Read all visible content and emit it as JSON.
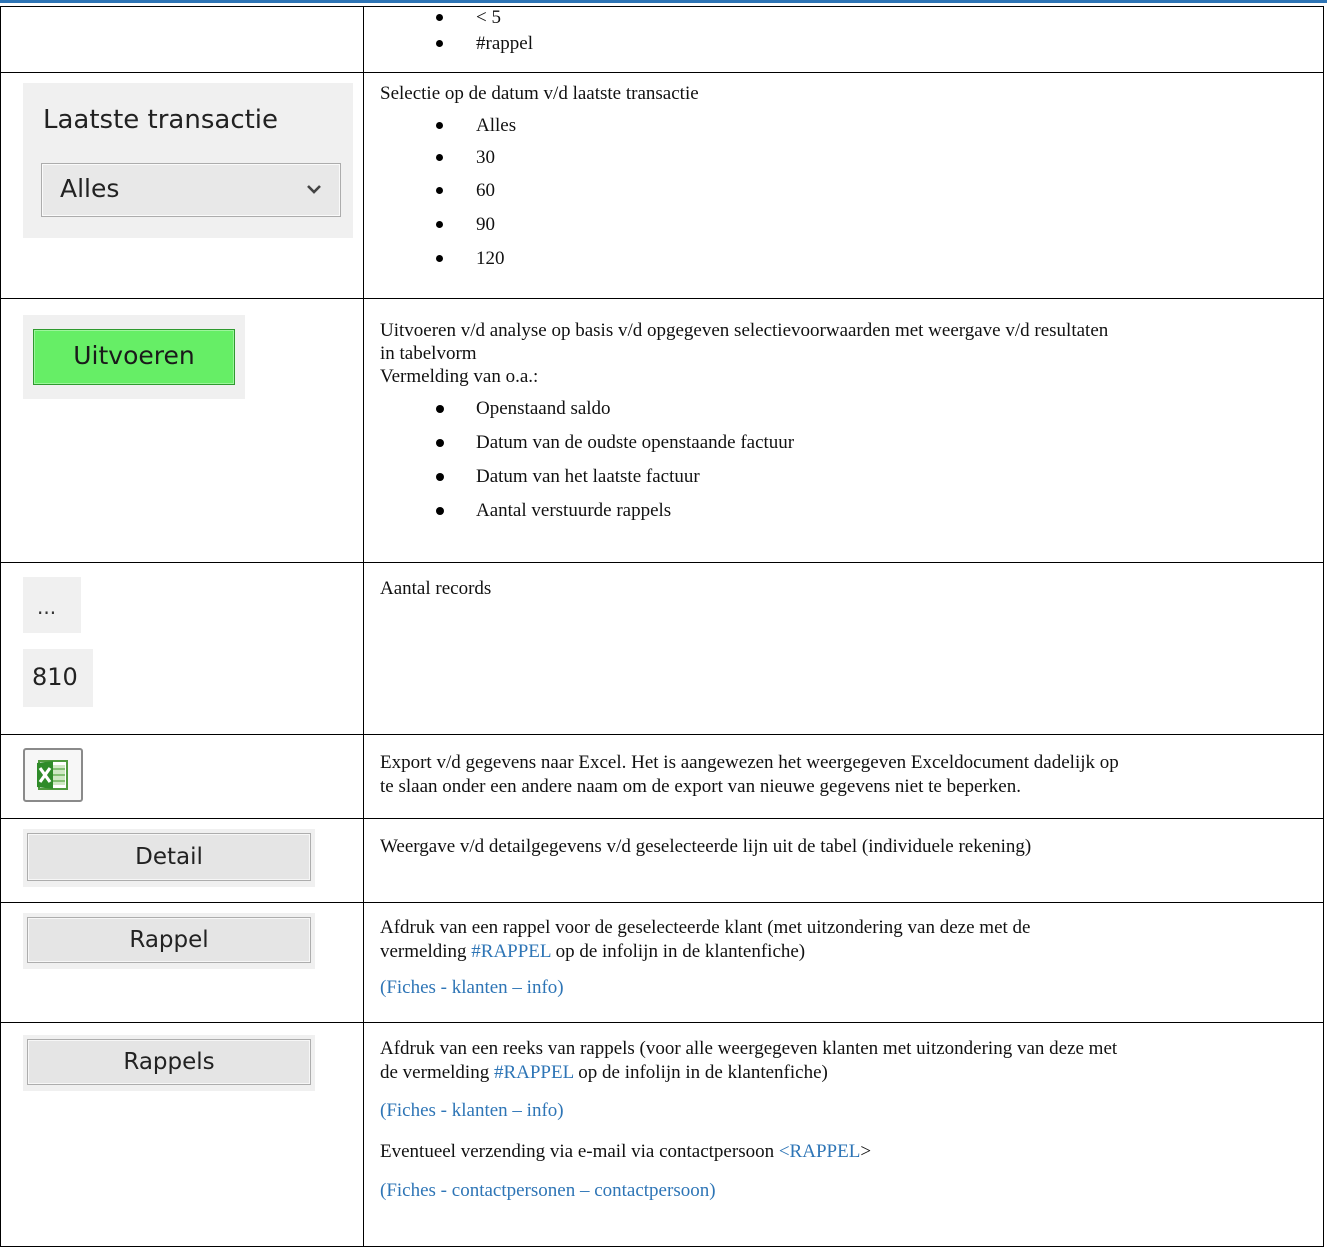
{
  "rows": {
    "r1": {
      "bullets": [
        "< 5",
        "#rappel"
      ]
    },
    "r2": {
      "label": "Laatste transactie",
      "select_value": "Alles",
      "intro": "Selectie op de datum v/d laatste transactie",
      "bullets": [
        "Alles",
        "30",
        "60",
        "90",
        "120"
      ]
    },
    "r3": {
      "button": "Uitvoeren",
      "line1": "Uitvoeren v/d analyse op basis v/d opgegeven selectievoorwaarden met weergave v/d resultaten",
      "line2": "in tabelvorm",
      "line3": "Vermelding van o.a.:",
      "bullets": [
        "Openstaand saldo",
        "Datum van de oudste openstaande factuur",
        "Datum van het laatste factuur",
        "Aantal verstuurde rappels"
      ]
    },
    "r4": {
      "ellipsis": "...",
      "count": "810",
      "desc": "Aantal records"
    },
    "r5": {
      "line1": "Export v/d gegevens naar Excel. Het is aangewezen het weergegeven Exceldocument dadelijk op",
      "line2": "te slaan onder een andere naam om de export van nieuwe gegevens niet te beperken."
    },
    "r6": {
      "button": "Detail",
      "desc": "Weergave v/d detailgegevens v/d geselecteerde lijn uit de tabel (individuele rekening)"
    },
    "r7": {
      "button": "Rappel",
      "line1": "Afdruk van een rappel voor de geselecteerde klant (met uitzondering van deze met de",
      "line2_pre": "vermelding ",
      "line2_link": "#RAPPEL",
      "line2_post": " op de infolijn in de klantenfiche)",
      "ref": "(Fiches - klanten – info)"
    },
    "r8": {
      "button": "Rappels",
      "line1": "Afdruk van een reeks van rappels (voor alle weergegeven klanten met uitzondering van deze met",
      "line2_pre": "de vermelding ",
      "line2_link": "#RAPPEL",
      "line2_post": " op de infolijn in de klantenfiche)",
      "ref1": "(Fiches - klanten – info)",
      "email_pre": "Eventueel verzending via e-mail via contactpersoon ",
      "email_link": "<RAPPEL",
      "email_post": ">",
      "ref2": "(Fiches - contactpersonen – contactpersoon)"
    }
  },
  "colors": {
    "link": "#2e75b6",
    "run_button": "#66ee66",
    "top_rule": "#2e75b6"
  },
  "icons": {
    "excel": "excel-icon",
    "dropdown": "chevron-down-icon"
  }
}
